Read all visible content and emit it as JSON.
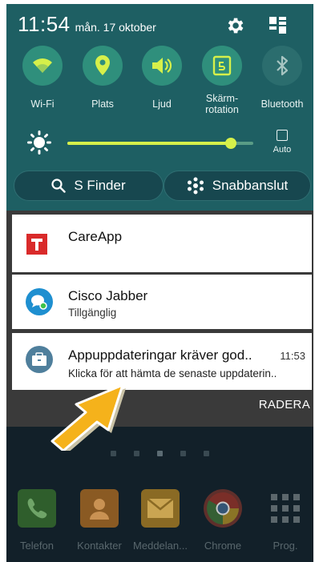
{
  "status": {
    "time": "11:54",
    "date": "mån. 17 oktober"
  },
  "toggles": [
    {
      "id": "wifi",
      "label": "Wi-Fi",
      "icon": "wifi-icon",
      "state": "on"
    },
    {
      "id": "location",
      "label": "Plats",
      "icon": "location-pin-icon",
      "state": "on"
    },
    {
      "id": "sound",
      "label": "Ljud",
      "icon": "speaker-icon",
      "state": "on"
    },
    {
      "id": "rotation",
      "label": "Skärm-\nrotation",
      "icon": "screen-rotation-icon",
      "state": "on"
    },
    {
      "id": "bluetooth",
      "label": "Bluetooth",
      "icon": "bluetooth-icon",
      "state": "off"
    }
  ],
  "brightness": {
    "level": 0.88,
    "auto_label": "Auto"
  },
  "buttons": {
    "sfinder": "S Finder",
    "quick_connect": "Snabbanslut"
  },
  "notifications": [
    {
      "app": "CareApp",
      "subtitle": "",
      "time": "",
      "icon": "careapp-icon"
    },
    {
      "app": "Cisco Jabber",
      "subtitle": "Tillgänglig",
      "time": "",
      "icon": "cisco-jabber-icon"
    },
    {
      "app": "Appuppdateringar kräver god..",
      "subtitle": "Klicka för att hämta de senaste uppdaterin..",
      "time": "11:53",
      "icon": "briefcase-icon"
    }
  ],
  "clear_label": "RADERA",
  "dock": [
    {
      "label": "Telefon",
      "icon": "phone-icon"
    },
    {
      "label": "Kontakter",
      "icon": "contacts-icon"
    },
    {
      "label": "Meddelan...",
      "icon": "messages-icon"
    },
    {
      "label": "Chrome",
      "icon": "chrome-icon"
    },
    {
      "label": "Prog.",
      "icon": "apps-grid-icon"
    }
  ],
  "colors": {
    "panel": "#1e5f63",
    "toggle_on": "#2f8f7c",
    "slider": "#d6f04a",
    "arrow": "#f5b21b"
  }
}
